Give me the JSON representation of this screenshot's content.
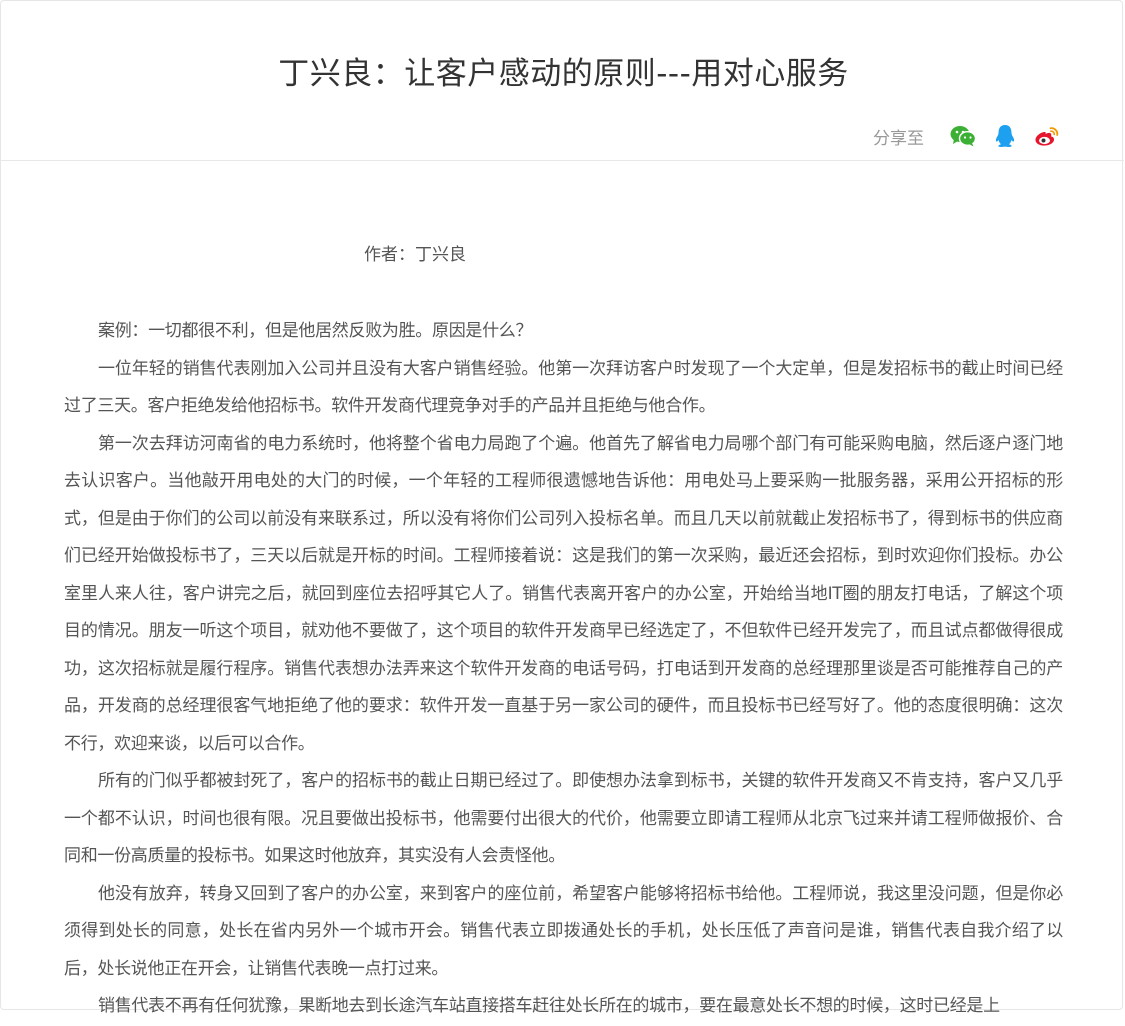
{
  "article": {
    "title": "丁兴良：让客户感动的原则---用对心服务",
    "author_line": "作者：丁兴良",
    "paragraphs": [
      "案例：一切都很不利，但是他居然反败为胜。原因是什么？",
      "一位年轻的销售代表刚加入公司并且没有大客户销售经验。他第一次拜访客户时发现了一个大定单，但是发招标书的截止时间已经过了三天。客户拒绝发给他招标书。软件开发商代理竞争对手的产品并且拒绝与他合作。",
      "第一次去拜访河南省的电力系统时，他将整个省电力局跑了个遍。他首先了解省电力局哪个部门有可能采购电脑，然后逐户逐门地去认识客户。当他敲开用电处的大门的时候，一个年轻的工程师很遗憾地告诉他：用电处马上要采购一批服务器，采用公开招标的形式，但是由于你们的公司以前没有来联系过，所以没有将你们公司列入投标名单。而且几天以前就截止发招标书了，得到标书的供应商们已经开始做投标书了，三天以后就是开标的时间。工程师接着说：这是我们的第一次采购，最近还会招标，到时欢迎你们投标。办公室里人来人往，客户讲完之后，就回到座位去招呼其它人了。销售代表离开客户的办公室，开始给当地IT圈的朋友打电话，了解这个项目的情况。朋友一听这个项目，就劝他不要做了，这个项目的软件开发商早已经选定了，不但软件已经开发完了，而且试点都做得很成功，这次招标就是履行程序。销售代表想办法弄来这个软件开发商的电话号码，打电话到开发商的总经理那里谈是否可能推荐自己的产品，开发商的总经理很客气地拒绝了他的要求：软件开发一直基于另一家公司的硬件，而且投标书已经写好了。他的态度很明确：这次不行，欢迎来谈，以后可以合作。",
      "所有的门似乎都被封死了，客户的招标书的截止日期已经过了。即使想办法拿到标书，关键的软件开发商又不肯支持，客户又几乎一个都不认识，时间也很有限。况且要做出投标书，他需要付出很大的代价，他需要立即请工程师从北京飞过来并请工程师做报价、合同和一份高质量的投标书。如果这时他放弃，其实没有人会责怪他。",
      "他没有放弃，转身又回到了客户的办公室，来到客户的座位前，希望客户能够将招标书给他。工程师说，我这里没问题，但是你必须得到处长的同意，处长在省内另外一个城市开会。销售代表立即拨通处长的手机，处长压低了声音问是谁，销售代表自我介绍了以后，处长说他正在开会，让销售代表晚一点打过来。",
      "销售代表不再有任何犹豫，果断地去到长途汽车站直接搭车赶往处长所在的城市，要在最意处长不想的时候，这时已经是上"
    ]
  },
  "share": {
    "label": "分享至",
    "buttons": [
      {
        "name": "wechat",
        "color": "#3cb034"
      },
      {
        "name": "qq",
        "color": "#1ea0f0"
      },
      {
        "name": "weibo",
        "color": "#e6162d"
      }
    ]
  }
}
